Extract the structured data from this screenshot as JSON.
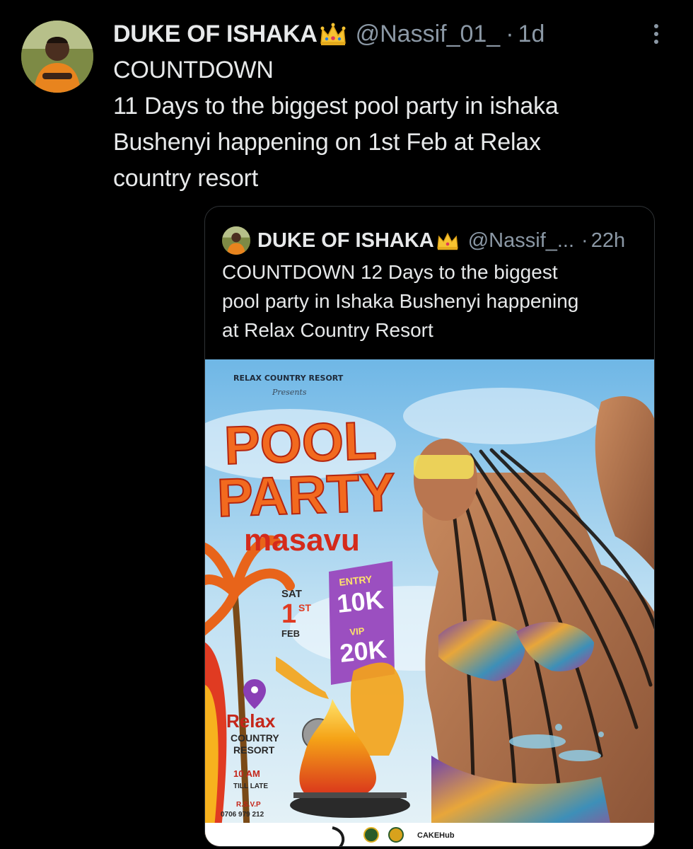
{
  "tweet": {
    "display_name": "DUKE OF ISHAKA",
    "handle": "@Nassif_01_",
    "separator": "·",
    "time": "1d",
    "text": "COUNTDOWN\n11 Days to the biggest pool party in ishaka\nBushenyi happening on 1st Feb at Relax\ncountry resort"
  },
  "quoted_tweet": {
    "display_name": "DUKE OF ISHAKA",
    "handle": "@Nassif_...",
    "separator": "·",
    "time": "22h",
    "text": "COUNTDOWN 12 Days to the biggest\npool party in Ishaka Bushenyi  happening\nat Relax Country Resort"
  },
  "poster": {
    "presenter": "RELAX COUNTRY RESORT",
    "presents": "Presents",
    "title_line1": "POOL",
    "title_line2": "PARTY",
    "subtitle": "masavu",
    "day": "SAT",
    "date_number": "1",
    "date_suffix": "ST",
    "month": "FEB",
    "entry_label": "ENTRY",
    "entry_price": "10K",
    "vip_label": "VIP",
    "vip_price": "20K",
    "venue_line1": "Relax",
    "venue_line2": "COUNTRY",
    "venue_line3": "RESORT",
    "time_start": "10 AM",
    "time_end": "TILL LATE",
    "rsvp_label": "R.S.V.P",
    "rsvp_phone": "0706 979 212",
    "sponsor": "CAKEHub"
  },
  "icons": {
    "more": "more-dots-icon",
    "crown": "crown-emoji-icon",
    "location": "location-pin-icon"
  },
  "colors": {
    "background": "#000000",
    "text_primary": "#e7e9ea",
    "text_secondary": "#8b98a5",
    "border": "#2f3336",
    "title_orange": "#f26a1f",
    "title_red": "#d42a1b",
    "price_purple": "#9b4fc0"
  }
}
